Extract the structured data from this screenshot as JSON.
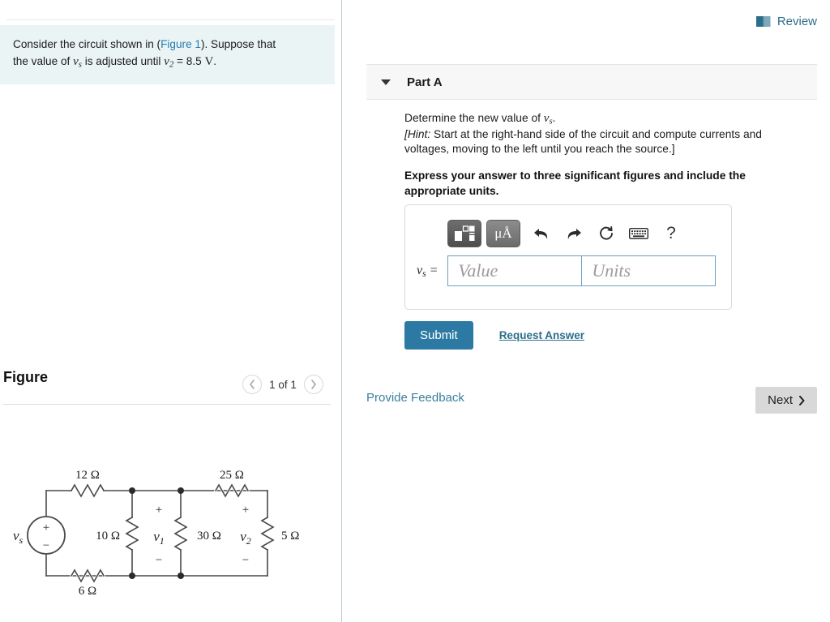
{
  "left": {
    "problem": {
      "line1_pre": "Consider the circuit shown in (",
      "figure_link": "Figure 1",
      "line1_post": "). Suppose that",
      "line2_pre": "the value of ",
      "var_vs": "v",
      "var_vs_sub": "s",
      "line2_mid": " is adjusted until ",
      "var_v2": "v",
      "var_v2_sub": "2",
      "line2_post": " = 8.5 ",
      "unit_volt": "V",
      "line2_end": "."
    },
    "figure": {
      "title": "Figure",
      "counter": "1 of 1",
      "prev_icon": "chevron-left-icon",
      "next_icon": "chevron-right-icon"
    }
  },
  "right": {
    "review": {
      "label": "Review",
      "icon": "book-icon"
    },
    "part": {
      "title": "Part A",
      "caret_icon": "caret-down-icon"
    },
    "question": {
      "line1_pre": "Determine the new value of ",
      "line1_var": "v",
      "line1_var_sub": "s",
      "line1_post": ".",
      "hint_label": "[Hint:",
      "hint_text": " Start at the right-hand side of the circuit and compute currents and voltages, moving to the left until you reach the source.]",
      "bold_instruction": "Express your answer to three significant figures and include the appropriate units."
    },
    "toolbar": {
      "template_button": "template-icon",
      "units_button": "μÅ",
      "undo_icon": "undo-icon",
      "redo_icon": "redo-icon",
      "reset_icon": "reset-icon",
      "keyboard_icon": "keyboard-icon",
      "help_icon": "?"
    },
    "answer": {
      "variable": "v",
      "variable_sub": "s",
      "equals": " =",
      "value_placeholder": "Value",
      "units_placeholder": "Units",
      "value_current": "",
      "units_current": ""
    },
    "actions": {
      "submit": "Submit",
      "request_answer": "Request Answer",
      "provide_feedback": "Provide Feedback",
      "next": "Next",
      "next_icon": "chevron-right-icon"
    }
  },
  "colors": {
    "accent_blue": "#2c7aa3",
    "link_blue": "#2c6e8a",
    "problem_bg": "#eaf4f4",
    "panel_header_bg": "#f7f7f7",
    "input_border": "#6e9fc0"
  },
  "circuit": {
    "source_label": "v",
    "source_sub": "s",
    "source_plus": "+",
    "source_minus": "−",
    "r_top_left": "12 Ω",
    "r_bottom_left": "6 Ω",
    "r_shunt_1": "10 Ω",
    "r_shunt_2": "30 Ω",
    "r_top_right": "25 Ω",
    "r_shunt_3": "5 Ω",
    "v1_label": "v",
    "v1_sub": "1",
    "v1_plus": "+",
    "v1_minus": "−",
    "v2_label": "v",
    "v2_sub": "2",
    "v2_plus": "+",
    "v2_minus": "−"
  }
}
